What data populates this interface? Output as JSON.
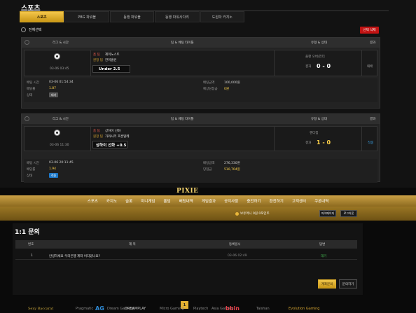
{
  "sports": {
    "title": "스포츠",
    "tabs": [
      "스포츠",
      "PBG 파워볼",
      "동행 파워볼",
      "동행 파워사다리",
      "도원파 카지노"
    ],
    "select_all": "전체선택",
    "delete_label": "선택 삭제"
  },
  "columns": {
    "league_time": "리그 & 시간",
    "team_betting": "팀 & 베팅 타이틀",
    "result_status": "유형 & 상태",
    "outcome": "결과"
  },
  "bets": [
    {
      "date": "03-06 03:45",
      "home_label": "홈 팀",
      "home_team": "제미노스트",
      "away_label": "원정 팀",
      "away_team": "한미홈런",
      "pick": "Under 2.5",
      "result_type": "플핸 오버/언더",
      "score_label": "결과",
      "score": "0 - 0",
      "outcome": "패배",
      "bet_time_label": "배팅 시간",
      "bet_time": "03-06 01:54:34",
      "odds_label": "배당률",
      "odds": "1.87",
      "status_label": "상태",
      "status": "대기",
      "bet_amount_label": "배팅금액",
      "bet_amount": "100,000원",
      "payout_label": "예상당첨금",
      "payout": "0원"
    },
    {
      "date": "03-06 11:30",
      "home_label": "홈 팀",
      "home_team": "상하이 선화",
      "away_label": "원정 팀",
      "away_team": "가와사키 프론탈레",
      "pick": "상하이 선화 +0.5",
      "result_type": "핸디캡",
      "score_label": "결과",
      "score": "1 - 0",
      "outcome": "적중",
      "bet_time_label": "배팅 시간",
      "bet_time": "03-06 20:11:45",
      "odds_label": "배당률",
      "odds": "1.94",
      "status_label": "상태",
      "status": "적중",
      "bet_amount_label": "배팅금액",
      "bet_amount": "276,330원",
      "payout_label": "당첨금",
      "payout": "510,704원"
    }
  ],
  "site": {
    "logo": "PIXIE",
    "nav": [
      "스포츠",
      "카지노",
      "슬롯",
      "미니게임",
      "홀덤",
      "배팅내역",
      "게임결과",
      "공지사항",
      "충전하기",
      "환전하기",
      "고객센터",
      "쿠폰내역"
    ],
    "user_info": "보유머니 0원  0포인트",
    "mypage_button": "마이페이지",
    "logout_button": "로그아웃"
  },
  "inquiry": {
    "title": "1:1 문의",
    "headers": [
      "번호",
      "제 목",
      "등록일시",
      "답변"
    ],
    "rows": [
      {
        "no": "1",
        "subject": "안녕하세요 우리은행 계좌 어디있나요?",
        "date": "03-06 02:49",
        "status": "대기"
      }
    ],
    "page": "1",
    "write_button": "계좌문의",
    "new_button": "문의하기"
  },
  "partners": [
    "Sexy Baccarat",
    "Pragmatic",
    "AG",
    "Dream Gaming",
    "DREAMPLAY",
    "Micro Gaming",
    "Playtech",
    "Asia Gaming",
    "bbin",
    "Taishan",
    "Evolution Gaming"
  ]
}
